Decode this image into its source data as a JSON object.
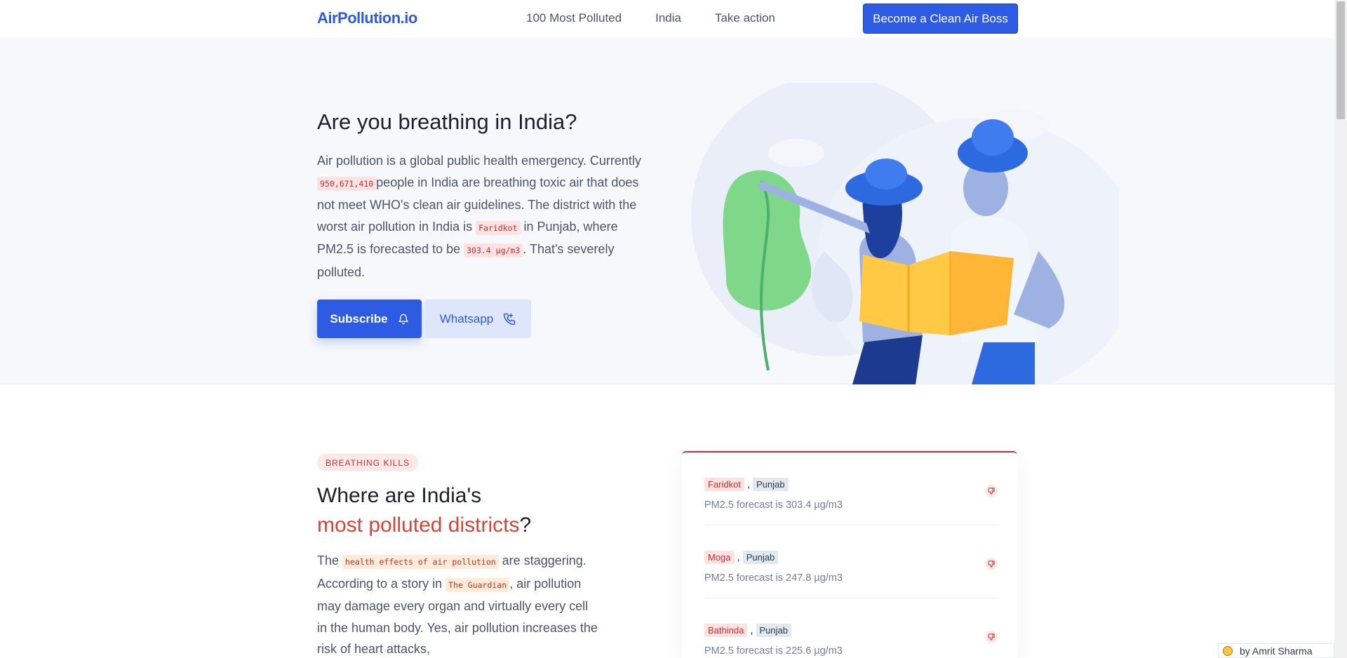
{
  "header": {
    "logo": "AirPollution.io",
    "nav": [
      "100 Most Polluted",
      "India",
      "Take action"
    ],
    "cta": "Become a Clean Air Boss"
  },
  "hero": {
    "title": "Are you breathing in India?",
    "text_1": "Air pollution is a global public health emergency. Currently ",
    "population": "950,671,410",
    "text_2": "people in India are breathing toxic air that does not meet WHO's clean air guidelines. The district with the worst air pollution in India is ",
    "worst_district": "Faridkot",
    "text_3": " in Punjab, where PM2.5 is forecasted to be ",
    "pm_value": "303.4 µg/m3",
    "text_4": ". That's severely polluted.",
    "subscribe_label": "Subscribe",
    "whatsapp_label": "Whatsapp"
  },
  "section": {
    "badge": "BREATHING KILLS",
    "title_1": "Where are India's",
    "title_red": "most polluted districts",
    "title_end": "?",
    "text_1": "The ",
    "link_1": "health effects of air pollution",
    "text_2": " are staggering. According to a story in ",
    "link_2": "The Guardian",
    "text_3": ", air pollution may damage every organ and virtually every cell in the human body. Yes, air pollution increases the risk of heart attacks,"
  },
  "districts": [
    {
      "district": "Faridkot",
      "state": "Punjab",
      "forecast": "PM2.5 forecast is 303.4 µg/m3"
    },
    {
      "district": "Moga",
      "state": "Punjab",
      "forecast": "PM2.5 forecast is 247.8 µg/m3"
    },
    {
      "district": "Bathinda",
      "state": "Punjab",
      "forecast": "PM2.5 forecast is 225.6 µg/m3"
    }
  ],
  "footer": {
    "author": "by Amrit Sharma"
  }
}
